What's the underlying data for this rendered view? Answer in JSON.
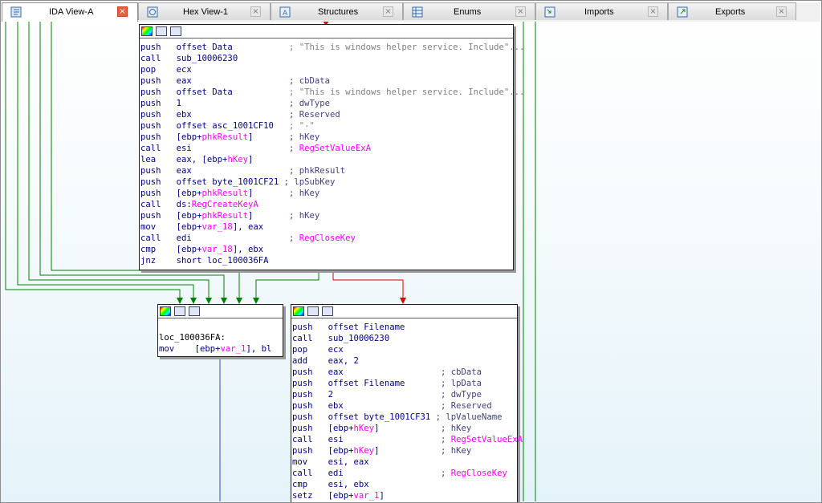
{
  "tabs": [
    {
      "label": "IDA View-A",
      "icon": "ida-view-icon",
      "active": true
    },
    {
      "label": "Hex View-1",
      "icon": "hex-view-icon",
      "active": false
    },
    {
      "label": "Structures",
      "icon": "structures-icon",
      "active": false
    },
    {
      "label": "Enums",
      "icon": "enums-icon",
      "active": false
    },
    {
      "label": "Imports",
      "icon": "imports-icon",
      "active": false
    },
    {
      "label": "Exports",
      "icon": "exports-icon",
      "active": false
    }
  ],
  "tab_close_glyph": "×",
  "colors": {
    "true_branch": "#008000",
    "false_branch": "#e00000",
    "unconditional": "#4040d0",
    "mnemonic": "#000080",
    "api_name": "#ff00ff",
    "comment": "#404080",
    "string_comment": "#7f7f7f"
  },
  "block_top": {
    "lines": [
      {
        "mn": "push",
        "op": "offset Data",
        "cm": "; \"This is windows helper service. Include\"...",
        "cmkind": "gr"
      },
      {
        "mn": "call",
        "op": "sub_10006230",
        "cm": "",
        "cmkind": ""
      },
      {
        "mn": "pop",
        "op": "ecx",
        "cm": "",
        "cmkind": ""
      },
      {
        "mn": "push",
        "op": "eax",
        "cm": "; cbData",
        "cmkind": "cm"
      },
      {
        "mn": "push",
        "op": "offset Data",
        "cm": "; \"This is windows helper service. Include\"...",
        "cmkind": "gr"
      },
      {
        "mn": "push",
        "op": "1",
        "cm": "; dwType",
        "cmkind": "cm"
      },
      {
        "mn": "push",
        "op": "ebx",
        "cm": "; Reserved",
        "cmkind": "cm"
      },
      {
        "mn": "push",
        "op": "offset asc_1001CF10",
        "cm": "; \"-\"",
        "cmkind": "gr"
      },
      {
        "mn": "push",
        "op": "[ebp+phkResult]",
        "cm": "; hKey",
        "cmkind": "cm"
      },
      {
        "mn": "call",
        "op": "esi",
        "cm": "; RegSetValueExA",
        "cmkind": "fn"
      },
      {
        "mn": "lea",
        "op": "eax, [ebp+hKey]",
        "cm": "",
        "cmkind": ""
      },
      {
        "mn": "push",
        "op": "eax",
        "cm": "; phkResult",
        "cmkind": "cm"
      },
      {
        "mn": "push",
        "op": "offset byte_1001CF21",
        "cm": "; lpSubKey",
        "cmkind": "cm"
      },
      {
        "mn": "push",
        "op": "[ebp+phkResult]",
        "cm": "; hKey",
        "cmkind": "cm"
      },
      {
        "mn": "call",
        "op": "ds:RegCreateKeyA",
        "cm": "",
        "cmkind": ""
      },
      {
        "mn": "push",
        "op": "[ebp+phkResult]",
        "cm": "; hKey",
        "cmkind": "cm"
      },
      {
        "mn": "mov",
        "op": "[ebp+var_18], eax",
        "cm": "",
        "cmkind": ""
      },
      {
        "mn": "call",
        "op": "edi",
        "cm": "; RegCloseKey",
        "cmkind": "fn"
      },
      {
        "mn": "cmp",
        "op": "[ebp+var_18], ebx",
        "cm": "",
        "cmkind": ""
      },
      {
        "mn": "jnz",
        "op": "short loc_100036FA",
        "cm": "",
        "cmkind": ""
      }
    ]
  },
  "block_left": {
    "label": "loc_100036FA:",
    "lines": [
      {
        "mn": "mov",
        "op": "[ebp+var_1], bl",
        "cm": "",
        "cmkind": ""
      }
    ]
  },
  "block_right": {
    "lines": [
      {
        "mn": "push",
        "op": "offset Filename",
        "cm": "",
        "cmkind": ""
      },
      {
        "mn": "call",
        "op": "sub_10006230",
        "cm": "",
        "cmkind": ""
      },
      {
        "mn": "pop",
        "op": "ecx",
        "cm": "",
        "cmkind": ""
      },
      {
        "mn": "add",
        "op": "eax, 2",
        "cm": "",
        "cmkind": ""
      },
      {
        "mn": "push",
        "op": "eax",
        "cm": "; cbData",
        "cmkind": "cm"
      },
      {
        "mn": "push",
        "op": "offset Filename",
        "cm": "; lpData",
        "cmkind": "cm"
      },
      {
        "mn": "push",
        "op": "2",
        "cm": "; dwType",
        "cmkind": "cm"
      },
      {
        "mn": "push",
        "op": "ebx",
        "cm": "; Reserved",
        "cmkind": "cm"
      },
      {
        "mn": "push",
        "op": "offset byte_1001CF31",
        "cm": "; lpValueName",
        "cmkind": "cm"
      },
      {
        "mn": "push",
        "op": "[ebp+hKey]",
        "cm": "; hKey",
        "cmkind": "cm"
      },
      {
        "mn": "call",
        "op": "esi",
        "cm": "; RegSetValueExA",
        "cmkind": "fn"
      },
      {
        "mn": "push",
        "op": "[ebp+hKey]",
        "cm": "; hKey",
        "cmkind": "cm"
      },
      {
        "mn": "mov",
        "op": "esi, eax",
        "cm": "",
        "cmkind": ""
      },
      {
        "mn": "call",
        "op": "edi",
        "cm": "; RegCloseKey",
        "cmkind": "fn"
      },
      {
        "mn": "cmp",
        "op": "esi, ebx",
        "cm": "",
        "cmkind": ""
      },
      {
        "mn": "setz",
        "op": "[ebp+var_1]",
        "cm": "",
        "cmkind": ""
      }
    ]
  }
}
